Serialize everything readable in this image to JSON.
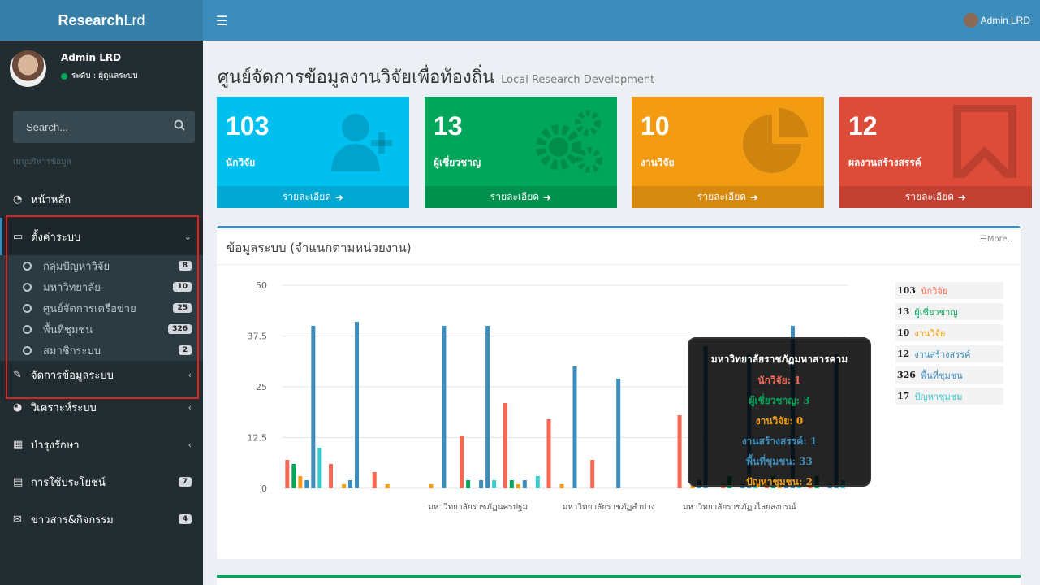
{
  "brand": {
    "bold": "Research",
    "light": "Lrd"
  },
  "user": {
    "name": "Admin LRD",
    "status": "ระดับ : ผู้ดูแลระบบ"
  },
  "search": {
    "placeholder": "Search..."
  },
  "menu_header": "เมนูบริหารข้อมูล",
  "menu": {
    "home": "หน้าหลัก",
    "settings": "ตั้งค่าระบบ",
    "manage": "จัดการข้อมูลระบบ",
    "analyze": "วิเคราะห์ระบบ",
    "maintain": "บำรุงรักษา",
    "utility": "การใช้ประโยชน์",
    "utility_badge": "7",
    "news": "ข่าวสาร&กิจกรรม",
    "news_badge": "4"
  },
  "submenu": [
    {
      "label": "กลุ่มปัญหาวิจัย",
      "badge": "8"
    },
    {
      "label": "มหาวิทยาลัย",
      "badge": "10"
    },
    {
      "label": "ศูนย์จัดการเครือข่าย",
      "badge": "25"
    },
    {
      "label": "พื้นที่ชุมชน",
      "badge": "326"
    },
    {
      "label": "สมาชิกระบบ",
      "badge": "2"
    }
  ],
  "header": {
    "user": "Admin LRD"
  },
  "page": {
    "title": "ศูนย์จัดการข้อมูลงานวิจัยเพื่อท้องถิ่น",
    "subtitle": "Local Research Development"
  },
  "cards": [
    {
      "value": "103",
      "label": "นักวิจัย",
      "footer": "รายละเอียด",
      "color": "#00c0ef",
      "icon": "user-plus-icon"
    },
    {
      "value": "13",
      "label": "ผู้เชี่ยวชาญ",
      "footer": "รายละเอียด",
      "color": "#00a65a",
      "icon": "gears-icon"
    },
    {
      "value": "10",
      "label": "งานวิจัย",
      "footer": "รายละเอียด",
      "color": "#f39c12",
      "icon": "pie-chart-icon"
    },
    {
      "value": "12",
      "label": "ผลงานสร้างสรรค์",
      "footer": "รายละเอียด",
      "color": "#dd4b39",
      "icon": "bookmark-icon"
    }
  ],
  "chart_box": {
    "title": "ข้อมูลระบบ (จำแนกตามหน่วยงาน)",
    "more": "More.."
  },
  "legend": [
    {
      "value": "103",
      "label": "นักวิจัย",
      "color": "#f56954"
    },
    {
      "value": "13",
      "label": "ผู้เชี่ยวชาญ",
      "color": "#00a65a"
    },
    {
      "value": "10",
      "label": "งานวิจัย",
      "color": "#f39c12"
    },
    {
      "value": "12",
      "label": "งานสร้างสรรค์",
      "color": "#3c8dbc"
    },
    {
      "value": "326",
      "label": "พื้นที่ชุมชน",
      "color": "#3c8dbc"
    },
    {
      "value": "17",
      "label": "ปัญหาชุมชม",
      "color": "#39cccc"
    }
  ],
  "tooltip": {
    "title": "มหาวิทยาลัยราชภัฏมหาสารคาม",
    "lines": [
      {
        "text": "นักวิจัย: 1",
        "color": "#f56954"
      },
      {
        "text": "ผู้เชี่ยวชาญ: 3",
        "color": "#00a65a"
      },
      {
        "text": "งานวิจัย: 0",
        "color": "#f39c12"
      },
      {
        "text": "งานสร้างสรรค์: 1",
        "color": "#3c8dbc"
      },
      {
        "text": "พื้นที่ชุมชน: 33",
        "color": "#3c8dbc"
      },
      {
        "text": "ปัญหาชุมชน: 2",
        "color": "#f39c12"
      }
    ]
  },
  "chart_data": {
    "type": "bar",
    "title": "",
    "xlabel": "",
    "ylabel": "",
    "ylim": [
      0,
      50
    ],
    "yticks": [
      "0",
      "12.5",
      "25",
      "37.5",
      "50"
    ],
    "categories": [
      "c1",
      "c2",
      "c3",
      "c4",
      "c5",
      "c6",
      "c7",
      "c8",
      "c9",
      "c10",
      "c11",
      "c12",
      "c13"
    ],
    "xtick_labels": [
      {
        "category": 4,
        "text": "มหาวิทยาลัยราชภัฏนครปฐม"
      },
      {
        "category": 7,
        "text": "มหาวิทยาลัยราชภัฏลำปาง"
      },
      {
        "category": 10,
        "text": "มหาวิทยาลัยราชภัฏวไลยลงกรณ์"
      }
    ],
    "series": [
      {
        "color": "#f56954",
        "values": [
          7,
          6,
          4,
          0,
          13,
          21,
          17,
          7,
          0,
          18,
          1,
          1,
          1
        ]
      },
      {
        "color": "#00a65a",
        "values": [
          6,
          0,
          0,
          0,
          2,
          2,
          0,
          0,
          0,
          0,
          3,
          3,
          3
        ]
      },
      {
        "color": "#f39c12",
        "values": [
          3,
          1,
          1,
          1,
          0,
          1,
          1,
          0,
          0,
          1,
          0,
          2,
          0
        ]
      },
      {
        "color": "#3c8dbc",
        "values": [
          2,
          2,
          0,
          0,
          2,
          2,
          0,
          0,
          0,
          2,
          1,
          1,
          1
        ]
      },
      {
        "color": "#3c8dbc",
        "values": [
          40,
          41,
          0,
          40,
          40,
          0,
          30,
          27,
          0,
          35,
          33,
          40,
          33
        ]
      },
      {
        "color": "#39cccc",
        "values": [
          10,
          0,
          0,
          0,
          2,
          3,
          0,
          0,
          0,
          0,
          2,
          1,
          2
        ]
      }
    ]
  }
}
